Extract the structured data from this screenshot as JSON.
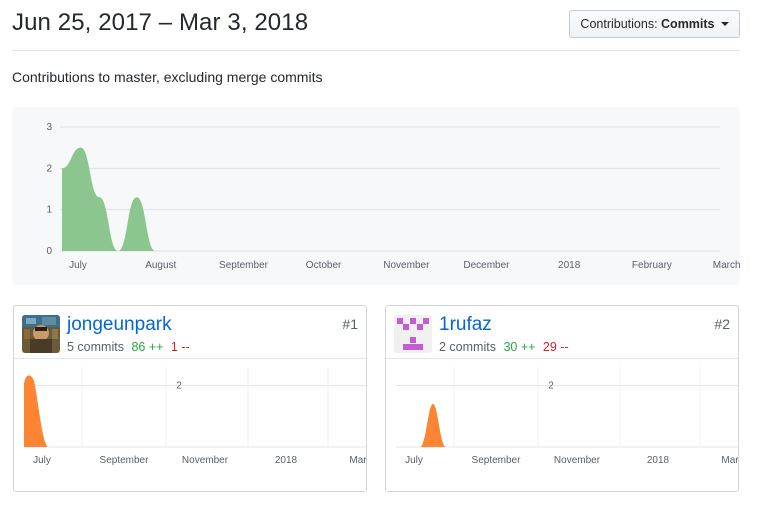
{
  "header": {
    "date_range": "Jun 25, 2017 – Mar 3, 2018",
    "select_label": "Contributions:",
    "select_value": "Commits"
  },
  "subtitle": "Contributions to master, excluding merge commits",
  "chart_data": [
    {
      "type": "area",
      "name": "overall-commits",
      "x_ticks": [
        "July",
        "August",
        "September",
        "October",
        "November",
        "December",
        "2018",
        "February",
        "March"
      ],
      "y_ticks": [
        "0",
        "1",
        "2",
        "3"
      ],
      "ylim": [
        0,
        3
      ],
      "color": "#8cc68f",
      "points": [
        {
          "x": "Jun 25, 2017",
          "y": 2
        },
        {
          "x": "Jul 2, 2017",
          "y": 2.5
        },
        {
          "x": "Jul 9, 2017",
          "y": 1.3
        },
        {
          "x": "Jul 16, 2017",
          "y": 0
        },
        {
          "x": "Jul 23, 2017",
          "y": 1.3
        },
        {
          "x": "Jul 30, 2017",
          "y": 0
        }
      ],
      "grid": true
    },
    {
      "type": "area",
      "name": "jongeunpark-commits",
      "x_ticks": [
        "July",
        "September",
        "November",
        "2018",
        "Mar"
      ],
      "y_ticks": [
        "2"
      ],
      "color": "#fb8532",
      "peak_value": 2.4,
      "grid": true
    },
    {
      "type": "area",
      "name": "1rufaz-commits",
      "x_ticks": [
        "July",
        "September",
        "November",
        "2018",
        "Mar"
      ],
      "y_ticks": [
        "2"
      ],
      "color": "#fb8532",
      "peak_value": 1.4,
      "grid": true
    }
  ],
  "contributors": [
    {
      "username": "jongeunpark",
      "commits": "5 commits",
      "additions": "86 ++",
      "deletions": "1 --",
      "rank": "#1"
    },
    {
      "username": "1rufaz",
      "commits": "2 commits",
      "additions": "30 ++",
      "deletions": "29 --",
      "rank": "#2"
    }
  ],
  "colors": {
    "link": "#0366d6",
    "additions": "#28a745",
    "deletions": "#cb2431",
    "main_area": "#8cc68f",
    "card_area": "#fb8532",
    "identicon": "#c45cd3"
  }
}
